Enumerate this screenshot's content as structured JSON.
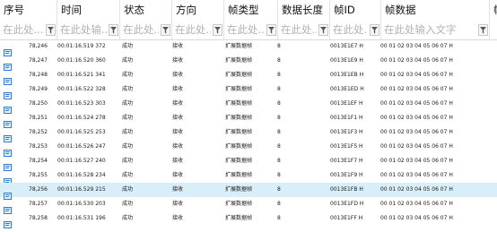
{
  "columns": [
    {
      "key": "seq",
      "label": "序号",
      "filter": "在此处..."
    },
    {
      "key": "time",
      "label": "时间",
      "filter": "在此处输..."
    },
    {
      "key": "status",
      "label": "状态",
      "filter": "在此处..."
    },
    {
      "key": "dir",
      "label": "方向",
      "filter": "在此处..."
    },
    {
      "key": "ftype",
      "label": "帧类型",
      "filter": "在此处..."
    },
    {
      "key": "dlen",
      "label": "数据长度",
      "filter": "在此处..."
    },
    {
      "key": "fid",
      "label": "帧ID",
      "filter": "在此处..."
    },
    {
      "key": "fdata",
      "label": "帧数据",
      "filter": "在此处输入文字"
    },
    {
      "key": "extra",
      "label": "帧",
      "filter": ""
    }
  ],
  "rows": [
    {
      "seq": "78,246",
      "time": "00:01:16.519 372",
      "status": "成功",
      "dir": "接收",
      "ftype": "扩展数据帧",
      "dlen": "8",
      "fid": "0013E1E7 H",
      "fdata": "00 01 02 03 04 05 06 07 H"
    },
    {
      "seq": "78,247",
      "time": "00:01:16.520 360",
      "status": "成功",
      "dir": "接收",
      "ftype": "扩展数据帧",
      "dlen": "8",
      "fid": "0013E1E9 H",
      "fdata": "00 01 02 03 04 05 06 07 H"
    },
    {
      "seq": "78,248",
      "time": "00:01:16.521 341",
      "status": "成功",
      "dir": "接收",
      "ftype": "扩展数据帧",
      "dlen": "8",
      "fid": "0013E1EB H",
      "fdata": "00 01 02 03 04 05 06 07 H"
    },
    {
      "seq": "78,249",
      "time": "00:01:16.522 328",
      "status": "成功",
      "dir": "接收",
      "ftype": "扩展数据帧",
      "dlen": "8",
      "fid": "0013E1ED H",
      "fdata": "00 01 02 03 04 05 06 07 H"
    },
    {
      "seq": "78,250",
      "time": "00:01:16.523 303",
      "status": "成功",
      "dir": "接收",
      "ftype": "扩展数据帧",
      "dlen": "8",
      "fid": "0013E1EF H",
      "fdata": "00 01 02 03 04 05 06 07 H"
    },
    {
      "seq": "78,251",
      "time": "00:01:16.524 278",
      "status": "成功",
      "dir": "接收",
      "ftype": "扩展数据帧",
      "dlen": "8",
      "fid": "0013E1F1 H",
      "fdata": "00 01 02 03 04 05 06 07 H"
    },
    {
      "seq": "78,252",
      "time": "00:01:16.525 253",
      "status": "成功",
      "dir": "接收",
      "ftype": "扩展数据帧",
      "dlen": "8",
      "fid": "0013E1F3 H",
      "fdata": "00 01 02 03 04 05 06 07 H"
    },
    {
      "seq": "78,253",
      "time": "00:01:16.526 247",
      "status": "成功",
      "dir": "接收",
      "ftype": "扩展数据帧",
      "dlen": "8",
      "fid": "0013E1F5 H",
      "fdata": "00 01 02 03 04 05 06 07 H"
    },
    {
      "seq": "78,254",
      "time": "00:01:16.527 240",
      "status": "成功",
      "dir": "接收",
      "ftype": "扩展数据帧",
      "dlen": "8",
      "fid": "0013E1F7 H",
      "fdata": "00 01 02 03 04 05 06 07 H"
    },
    {
      "seq": "78,255",
      "time": "00:01:16.528 234",
      "status": "成功",
      "dir": "接收",
      "ftype": "扩展数据帧",
      "dlen": "8",
      "fid": "0013E1F9 H",
      "fdata": "00 01 02 03 04 05 06 07 H"
    },
    {
      "seq": "78,256",
      "time": "00:01:16.529 215",
      "status": "成功",
      "dir": "接收",
      "ftype": "扩展数据帧",
      "dlen": "8",
      "fid": "0013E1FB H",
      "fdata": "00 01 02 03 04 05 06 07 H",
      "selected": true
    },
    {
      "seq": "78,257",
      "time": "00:01:16.530 203",
      "status": "成功",
      "dir": "接收",
      "ftype": "扩展数据帧",
      "dlen": "8",
      "fid": "0013E1FD H",
      "fdata": "00 01 02 03 04 05 06 07 H"
    },
    {
      "seq": "78,258",
      "time": "00:01:16.531 196",
      "status": "成功",
      "dir": "接收",
      "ftype": "扩展数据帧",
      "dlen": "8",
      "fid": "0013E1FF H",
      "fdata": "00 01 02 03 04 05 06 07 H"
    }
  ],
  "icons": {
    "row": "message-row-icon",
    "filter": "filter-funnel-icon"
  },
  "colors": {
    "selected_row": "#d8eef8",
    "icon_blue": "#3a78c8"
  }
}
